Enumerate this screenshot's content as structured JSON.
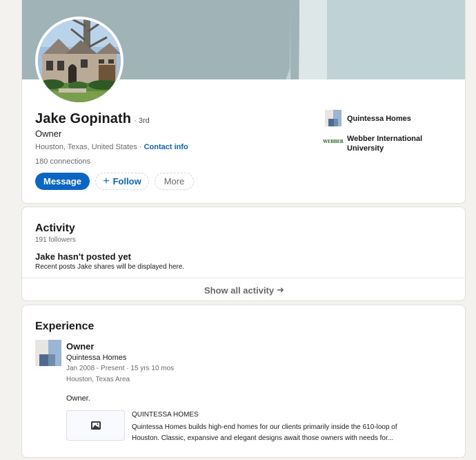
{
  "profile": {
    "name": "Jake Gopinath",
    "degree": "· 3rd",
    "headline": "Owner",
    "location": "Houston, Texas, United States",
    "location_sep": " · ",
    "contact_info": "Contact info",
    "connections": "180 connections",
    "actions": {
      "message": "Message",
      "follow_icon": "+",
      "follow": "Follow",
      "more": "More"
    },
    "side": [
      {
        "name": "Quintessa Homes",
        "icon": "quintessa-logo"
      },
      {
        "name": "Webber International University",
        "icon": "webber-logo",
        "logo_text": "WEBBER"
      }
    ],
    "colors": {
      "primary": "#0a66c2",
      "cover": "#bfd3d6",
      "cover_dark": "#a0b4b7"
    }
  },
  "activity": {
    "title": "Activity",
    "followers": "191 followers",
    "empty_title": "Jake hasn't posted yet",
    "empty_subtitle": "Recent posts Jake shares will be displayed here.",
    "show_all": "Show all activity",
    "show_all_arrow": "➜"
  },
  "experience": {
    "title": "Experience",
    "items": [
      {
        "title": "Owner",
        "company": "Quintessa Homes",
        "dates": "Jan 2008 - Present · 15 yrs 10 mos",
        "location": "Houston, Texas Area",
        "description": "Owner.",
        "media": {
          "title": "QUINTESSA HOMES",
          "description_line1": "Quintessa Homes builds high-end homes for our clients primarily inside the 610-loop of",
          "description_line2": "Houston. Classic, expansive and elegant designs await those owners with needs for..."
        }
      }
    ]
  }
}
